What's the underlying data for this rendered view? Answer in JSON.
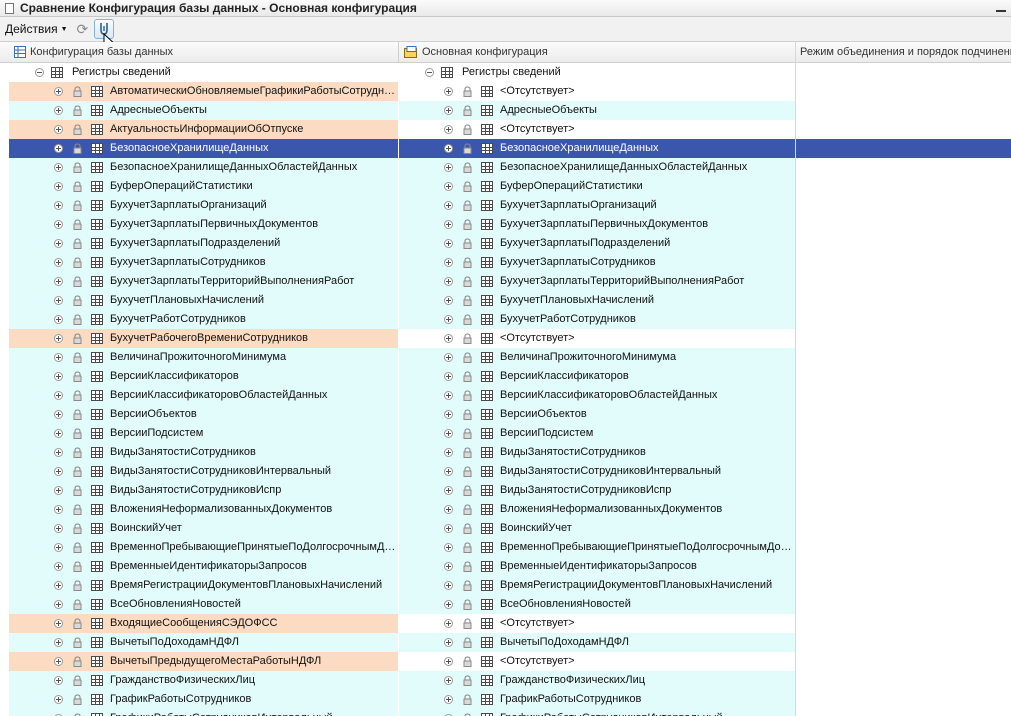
{
  "window": {
    "title": "Сравнение Конфигурация базы данных - Основная конфигурация"
  },
  "toolbar": {
    "actions_label": "Действия"
  },
  "columns": {
    "left": "Конфигурация базы данных",
    "right": "Основная конфигурация",
    "mode": "Режим объединения и порядок подчиненн"
  },
  "group": {
    "left": "Регистры сведений",
    "right": "Регистры сведений"
  },
  "colors": {
    "differs": "#fbdcc2",
    "same": "#e2fbfb",
    "selected": "#3b57ad"
  },
  "rows": [
    {
      "left": "АвтоматическиОбновляемыеГрафикиРаботыСотрудн…",
      "right": "<Отсутствует>",
      "status": "differs"
    },
    {
      "left": "АдресныеОбъекты",
      "right": "АдресныеОбъекты",
      "status": "same"
    },
    {
      "left": "АктуальностьИнформацииОбОтпуске",
      "right": "<Отсутствует>",
      "status": "differs"
    },
    {
      "left": "БезопасноеХранилищеДанных",
      "right": "БезопасноеХранилищеДанных",
      "status": "selected"
    },
    {
      "left": "БезопасноеХранилищеДанныхОбластейДанных",
      "right": "БезопасноеХранилищеДанныхОбластейДанных",
      "status": "same"
    },
    {
      "left": "БуферОперацийСтатистики",
      "right": "БуферОперацийСтатистики",
      "status": "same"
    },
    {
      "left": "БухучетЗарплатыОрганизаций",
      "right": "БухучетЗарплатыОрганизаций",
      "status": "same"
    },
    {
      "left": "БухучетЗарплатыПервичныхДокументов",
      "right": "БухучетЗарплатыПервичныхДокументов",
      "status": "same"
    },
    {
      "left": "БухучетЗарплатыПодразделений",
      "right": "БухучетЗарплатыПодразделений",
      "status": "same"
    },
    {
      "left": "БухучетЗарплатыСотрудников",
      "right": "БухучетЗарплатыСотрудников",
      "status": "same"
    },
    {
      "left": "БухучетЗарплатыТерриторийВыполненияРабот",
      "right": "БухучетЗарплатыТерриторийВыполненияРабот",
      "status": "same"
    },
    {
      "left": "БухучетПлановыхНачислений",
      "right": "БухучетПлановыхНачислений",
      "status": "same"
    },
    {
      "left": "БухучетРаботСотрудников",
      "right": "БухучетРаботСотрудников",
      "status": "same"
    },
    {
      "left": "БухучетРабочегоВремениСотрудников",
      "right": "<Отсутствует>",
      "status": "differs"
    },
    {
      "left": "ВеличинаПрожиточногоМинимума",
      "right": "ВеличинаПрожиточногоМинимума",
      "status": "same"
    },
    {
      "left": "ВерсииКлассификаторов",
      "right": "ВерсииКлассификаторов",
      "status": "same"
    },
    {
      "left": "ВерсииКлассификаторовОбластейДанных",
      "right": "ВерсииКлассификаторовОбластейДанных",
      "status": "same"
    },
    {
      "left": "ВерсииОбъектов",
      "right": "ВерсииОбъектов",
      "status": "same"
    },
    {
      "left": "ВерсииПодсистем",
      "right": "ВерсииПодсистем",
      "status": "same"
    },
    {
      "left": "ВидыЗанятостиСотрудников",
      "right": "ВидыЗанятостиСотрудников",
      "status": "same"
    },
    {
      "left": "ВидыЗанятостиСотрудниковИнтервальный",
      "right": "ВидыЗанятостиСотрудниковИнтервальный",
      "status": "same"
    },
    {
      "left": "ВидыЗанятостиСотрудниковИспр",
      "right": "ВидыЗанятостиСотрудниковИспр",
      "status": "same"
    },
    {
      "left": "ВложенияНеформализованныхДокументов",
      "right": "ВложенияНеформализованныхДокументов",
      "status": "same"
    },
    {
      "left": "ВоинскийУчет",
      "right": "ВоинскийУчет",
      "status": "same"
    },
    {
      "left": "ВременноПребывающиеПринятыеПоДолгосрочнымД…",
      "right": "ВременноПребывающиеПринятыеПоДолгосрочнымДо…",
      "status": "same"
    },
    {
      "left": "ВременныеИдентификаторыЗапросов",
      "right": "ВременныеИдентификаторыЗапросов",
      "status": "same"
    },
    {
      "left": "ВремяРегистрацииДокументовПлановыхНачислений",
      "right": "ВремяРегистрацииДокументовПлановыхНачислений",
      "status": "same"
    },
    {
      "left": "ВсеОбновленияНовостей",
      "right": "ВсеОбновленияНовостей",
      "status": "same"
    },
    {
      "left": "ВходящиеСообщенияСЭДОФСС",
      "right": "<Отсутствует>",
      "status": "differs"
    },
    {
      "left": "ВычетыПоДоходамНДФЛ",
      "right": "ВычетыПоДоходамНДФЛ",
      "status": "same"
    },
    {
      "left": "ВычетыПредыдущегоМестаРаботыНДФЛ",
      "right": "<Отсутствует>",
      "status": "differs"
    },
    {
      "left": "ГражданствоФизическихЛиц",
      "right": "ГражданствоФизическихЛиц",
      "status": "same"
    },
    {
      "left": "ГрафикРаботыСотрудников",
      "right": "ГрафикРаботыСотрудников",
      "status": "same"
    },
    {
      "left": "ГрафикиРаботыСотрудниковИнтервальный",
      "right": "ГрафикиРаботыСотрудниковИнтервальный",
      "status": "same"
    }
  ]
}
